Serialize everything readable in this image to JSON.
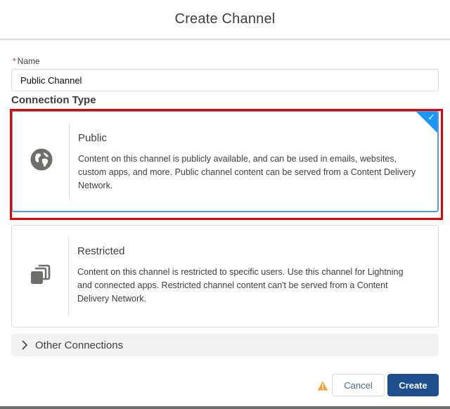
{
  "modal": {
    "title": "Create Channel"
  },
  "form": {
    "name_field": {
      "required_marker": "*",
      "label": "Name",
      "value": "Public Channel",
      "placeholder": ""
    },
    "section_title": "Connection Type",
    "connection_types": [
      {
        "id": "public",
        "icon": "globe-icon",
        "title": "Public",
        "description": "Content on this channel is publicly available, and can be used in emails, websites, custom apps, and more. Public channel content can be served from a Content Delivery Network.",
        "selected": true,
        "check_glyph": "✓"
      },
      {
        "id": "restricted",
        "icon": "stacked-pages-icon",
        "title": "Restricted",
        "description": "Content on this channel is restricted to specific users. Use this channel for Lightning and connected apps. Restricted channel content can't be served from a Content Delivery Network.",
        "selected": false
      }
    ],
    "other_connections": {
      "label": "Other Connections",
      "expanded": false
    }
  },
  "footer": {
    "warning_icon": "warning-icon",
    "cancel_label": "Cancel",
    "create_label": "Create"
  },
  "colors": {
    "selected_border": "#5a9bd6",
    "check_corner": "#1b96ff",
    "highlight": "#e00000",
    "primary_button": "#1f4e8c",
    "warning": "#f4a640",
    "required": "#c23934"
  }
}
